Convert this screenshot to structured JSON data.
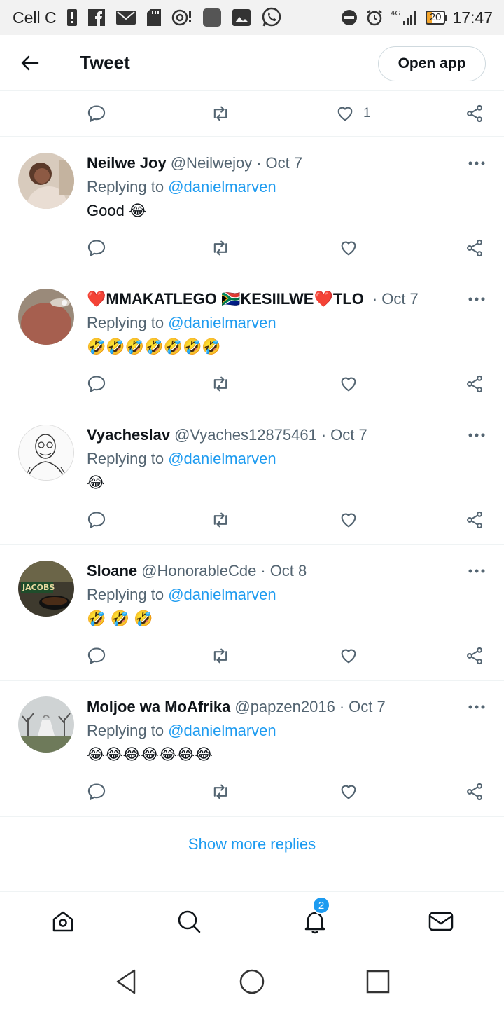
{
  "status_bar": {
    "carrier": "Cell C",
    "network": "4G",
    "battery": "20",
    "time": "17:47"
  },
  "header": {
    "title": "Tweet",
    "open_app_label": "Open app"
  },
  "top_actions": {
    "like_count": "1"
  },
  "replying_prefix": "Replying to",
  "tweets": [
    {
      "name": "Neilwe Joy",
      "handle": "@Neilwejoy",
      "sep": "·",
      "date": "Oct 7",
      "reply_to": "@danielmarven",
      "text": "Good 😂"
    },
    {
      "name": "❤️MMAKATLEGO 🇿🇦KESIILWE❤️TLO",
      "handle": "",
      "sep": "·",
      "date": "Oct 7",
      "reply_to": "@danielmarven",
      "text": "🤣🤣🤣🤣🤣🤣🤣"
    },
    {
      "name": "Vyacheslav",
      "handle": "@Vyaches12875461",
      "sep": "·",
      "date": "Oct 7",
      "reply_to": "@danielmarven",
      "text": "😂"
    },
    {
      "name": "Sloane",
      "handle": "@HonorableCde",
      "sep": "·",
      "date": "Oct 8",
      "reply_to": "@danielmarven",
      "text": "🤣 🤣 🤣"
    },
    {
      "name": "Moljoe wa MoAfrika",
      "handle": "@papzen2016",
      "sep": "·",
      "date": "Oct 7",
      "reply_to": "@danielmarven",
      "text": "😂😂😂😂😂😂😂"
    }
  ],
  "avatar_logo_text": "JACOBS",
  "show_more_label": "Show more replies",
  "bottom_nav": {
    "notifications_badge": "2"
  },
  "colors": {
    "accent": "#1d9bf0",
    "secondary_text": "#536471",
    "divider": "#eff3f4"
  }
}
